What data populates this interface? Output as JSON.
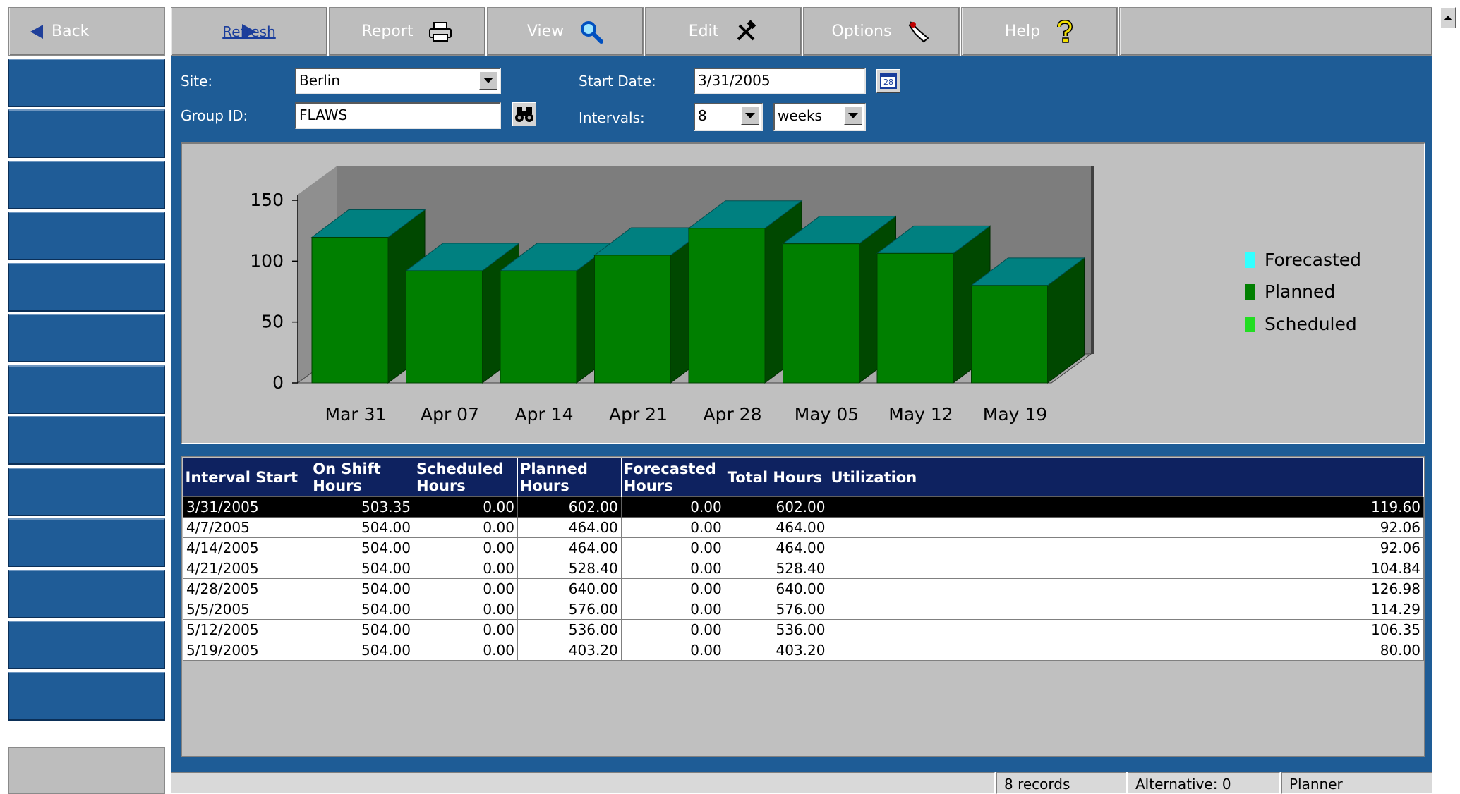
{
  "toolbar": {
    "back_label": "Back",
    "refresh_label": "Refresh",
    "report_label": "Report",
    "view_label": "View",
    "edit_label": "Edit",
    "options_label": "Options",
    "help_label": "Help",
    "icons": {
      "back": "triangle-left-icon",
      "refresh": "play-right-icon",
      "report": "printer-icon",
      "view": "magnifier-icon",
      "edit": "tools-icon",
      "options": "hand-pointer-icon",
      "help": "question-mark-icon"
    }
  },
  "form": {
    "site_label": "Site:",
    "site_value": "Berlin",
    "group_label": "Group ID:",
    "group_value": "FLAWS",
    "start_date_label": "Start Date:",
    "start_date_value": "3/31/2005",
    "calendar_icon_text": "28",
    "intervals_label": "Intervals:",
    "intervals_value": "8",
    "intervals_unit": "weeks"
  },
  "colors": {
    "forecasted": "#33ffff",
    "planned": "#007f00",
    "scheduled": "#22dd22",
    "bar_top": "#008080",
    "panel": "#1e5c96",
    "header_bg": "#0e2260"
  },
  "chart_data": {
    "type": "bar",
    "categories": [
      "Mar 31",
      "Apr 07",
      "Apr 14",
      "Apr 21",
      "Apr 28",
      "May 05",
      "May 12",
      "May 19"
    ],
    "series": [
      {
        "name": "Forecasted",
        "values": [
          0,
          0,
          0,
          0,
          0,
          0,
          0,
          0
        ]
      },
      {
        "name": "Planned",
        "values": [
          119.6,
          92.06,
          92.06,
          104.84,
          126.98,
          114.29,
          106.35,
          80.0
        ]
      },
      {
        "name": "Scheduled",
        "values": [
          0,
          0,
          0,
          0,
          0,
          0,
          0,
          0
        ]
      }
    ],
    "yticks": [
      "150",
      "100",
      "50",
      "0"
    ],
    "ylim": [
      0,
      150
    ],
    "legend_position": "right",
    "style": "3d"
  },
  "table": {
    "columns": [
      "Interval Start",
      "On Shift Hours",
      "Scheduled Hours",
      "Planned Hours",
      "Forecasted Hours",
      "Total Hours",
      "Utilization"
    ],
    "rows": [
      [
        "3/31/2005",
        "503.35",
        "0.00",
        "602.00",
        "0.00",
        "602.00",
        "119.60"
      ],
      [
        "4/7/2005",
        "504.00",
        "0.00",
        "464.00",
        "0.00",
        "464.00",
        "92.06"
      ],
      [
        "4/14/2005",
        "504.00",
        "0.00",
        "464.00",
        "0.00",
        "464.00",
        "92.06"
      ],
      [
        "4/21/2005",
        "504.00",
        "0.00",
        "528.40",
        "0.00",
        "528.40",
        "104.84"
      ],
      [
        "4/28/2005",
        "504.00",
        "0.00",
        "640.00",
        "0.00",
        "640.00",
        "126.98"
      ],
      [
        "5/5/2005",
        "504.00",
        "0.00",
        "576.00",
        "0.00",
        "576.00",
        "114.29"
      ],
      [
        "5/12/2005",
        "504.00",
        "0.00",
        "536.00",
        "0.00",
        "536.00",
        "106.35"
      ],
      [
        "5/19/2005",
        "504.00",
        "0.00",
        "403.20",
        "0.00",
        "403.20",
        "80.00"
      ]
    ]
  },
  "status": {
    "records": "8 records",
    "alternative": "Alternative: 0",
    "mode": "Planner"
  }
}
